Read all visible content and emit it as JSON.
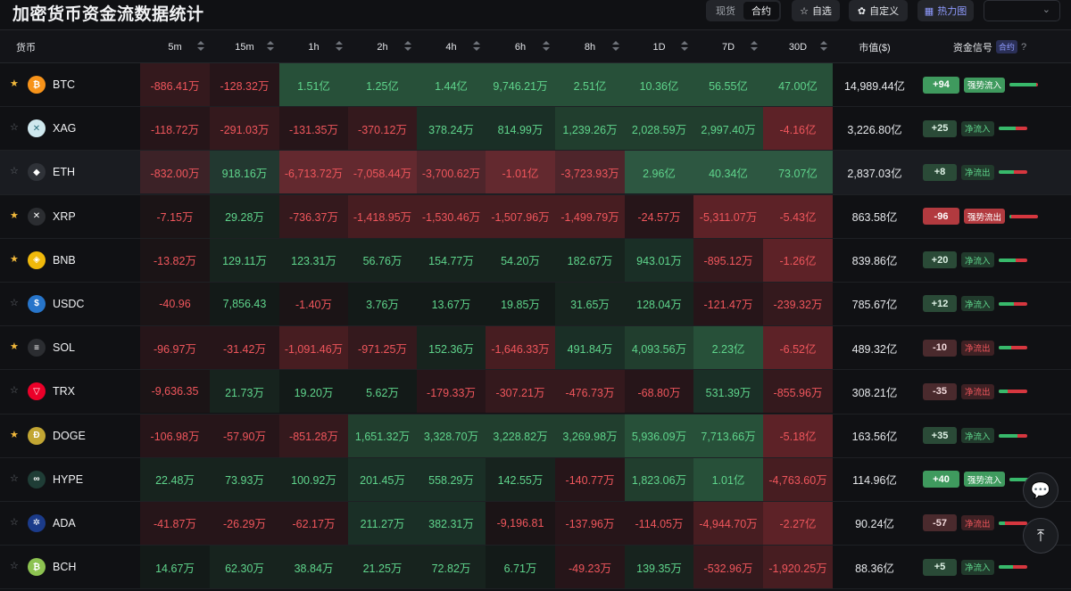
{
  "header": {
    "title": "加密货币资金流数据统计",
    "segment": [
      "现货",
      "合约"
    ],
    "segment_active": 1,
    "buttons": {
      "watchlist": "自选",
      "custom": "自定义",
      "heatmap": "热力图"
    }
  },
  "columns": {
    "coin": "货币",
    "periods": [
      "5m",
      "15m",
      "1h",
      "2h",
      "4h",
      "6h",
      "8h",
      "1D",
      "7D",
      "30D"
    ],
    "mcap": "市值($)",
    "signal": "资金信号",
    "signal_tag": "合约",
    "signal_help": "?"
  },
  "colors": {
    "positive": "#5fd58c",
    "negative": "#f0565c",
    "accent": "#8f9bff",
    "star": "#f2b93b"
  },
  "rows": [
    {
      "symbol": "BTC",
      "star": true,
      "icon": "btc-icon",
      "icon_glyph": "₿",
      "icon_color": "#f7931a",
      "values": [
        "-886.41万",
        "-128.32万",
        "1.51亿",
        "1.25亿",
        "1.44亿",
        "9,746.21万",
        "2.51亿",
        "10.36亿",
        "56.55亿",
        "47.00亿"
      ],
      "mcap": "14,989.44亿",
      "score": "+94",
      "signal": "强势流入",
      "signal_strength": 0.94
    },
    {
      "symbol": "XAG",
      "star": false,
      "icon": "xag-icon",
      "icon_glyph": "✕",
      "icon_color": "#cfe8ee",
      "values": [
        "-118.72万",
        "-291.03万",
        "-131.35万",
        "-370.12万",
        "378.24万",
        "814.99万",
        "1,239.26万",
        "2,028.59万",
        "2,997.40万",
        "-4.16亿"
      ],
      "mcap": "3,226.80亿",
      "score": "+25",
      "signal": "净流入",
      "signal_strength": 0.62
    },
    {
      "symbol": "ETH",
      "star": false,
      "icon": "eth-icon",
      "icon_glyph": "◆",
      "icon_color": "#2f3238",
      "values": [
        "-832.00万",
        "918.16万",
        "-6,713.72万",
        "-7,058.44万",
        "-3,700.62万",
        "-1.01亿",
        "-3,723.93万",
        "2.96亿",
        "40.34亿",
        "73.07亿"
      ],
      "mcap": "2,837.03亿",
      "score": "+8",
      "signal": "净流出",
      "signal_strength": 0.54
    },
    {
      "symbol": "XRP",
      "star": true,
      "icon": "xrp-icon",
      "icon_glyph": "✕",
      "icon_color": "#2b2d31",
      "values": [
        "-7.15万",
        "29.28万",
        "-736.37万",
        "-1,418.95万",
        "-1,530.46万",
        "-1,507.96万",
        "-1,499.79万",
        "-24.57万",
        "-5,311.07万",
        "-5.43亿"
      ],
      "mcap": "863.58亿",
      "score": "-96",
      "signal": "强势流出",
      "signal_strength": 0.06
    },
    {
      "symbol": "BNB",
      "star": true,
      "icon": "bnb-icon",
      "icon_glyph": "◈",
      "icon_color": "#f0b90b",
      "values": [
        "-13.82万",
        "129.11万",
        "123.31万",
        "56.76万",
        "154.77万",
        "54.20万",
        "182.67万",
        "943.01万",
        "-895.12万",
        "-1.26亿"
      ],
      "mcap": "839.86亿",
      "score": "+20",
      "signal": "净流入",
      "signal_strength": 0.6
    },
    {
      "symbol": "USDC",
      "star": false,
      "icon": "usdc-icon",
      "icon_glyph": "$",
      "icon_color": "#2775ca",
      "values": [
        "-40.96",
        "7,856.43",
        "-1.40万",
        "3.76万",
        "13.67万",
        "19.85万",
        "31.65万",
        "128.04万",
        "-121.47万",
        "-239.32万"
      ],
      "mcap": "785.67亿",
      "score": "+12",
      "signal": "净流入",
      "signal_strength": 0.56
    },
    {
      "symbol": "SOL",
      "star": true,
      "icon": "sol-icon",
      "icon_glyph": "≡",
      "icon_color": "#2b2d31",
      "values": [
        "-96.97万",
        "-31.42万",
        "-1,091.46万",
        "-971.25万",
        "152.36万",
        "-1,646.33万",
        "491.84万",
        "4,093.56万",
        "2.23亿",
        "-6.52亿"
      ],
      "mcap": "489.32亿",
      "score": "-10",
      "signal": "净流出",
      "signal_strength": 0.45
    },
    {
      "symbol": "TRX",
      "star": false,
      "icon": "trx-icon",
      "icon_glyph": "▽",
      "icon_color": "#eb0029",
      "values": [
        "-9,636.35",
        "21.73万",
        "19.20万",
        "5.62万",
        "-179.33万",
        "-307.21万",
        "-476.73万",
        "-68.80万",
        "531.39万",
        "-855.96万"
      ],
      "mcap": "308.21亿",
      "score": "-35",
      "signal": "净流出",
      "signal_strength": 0.33
    },
    {
      "symbol": "DOGE",
      "star": true,
      "icon": "doge-icon",
      "icon_glyph": "Ð",
      "icon_color": "#c2a633",
      "values": [
        "-106.98万",
        "-57.90万",
        "-851.28万",
        "1,651.32万",
        "3,328.70万",
        "3,228.82万",
        "3,269.98万",
        "5,936.09万",
        "7,713.66万",
        "-5.18亿"
      ],
      "mcap": "163.56亿",
      "score": "+35",
      "signal": "净流入",
      "signal_strength": 0.68
    },
    {
      "symbol": "HYPE",
      "star": false,
      "icon": "hype-icon",
      "icon_glyph": "∞",
      "icon_color": "#1f3d36",
      "values": [
        "22.48万",
        "73.93万",
        "100.92万",
        "201.45万",
        "558.29万",
        "142.55万",
        "-140.77万",
        "1,823.06万",
        "1.01亿",
        "-4,763.60万"
      ],
      "mcap": "114.96亿",
      "score": "+40",
      "signal": "强势流入",
      "signal_strength": 0.72
    },
    {
      "symbol": "ADA",
      "star": false,
      "icon": "ada-icon",
      "icon_glyph": "✲",
      "icon_color": "#1b3b8a",
      "values": [
        "-41.87万",
        "-26.29万",
        "-62.17万",
        "211.27万",
        "382.31万",
        "-9,196.81",
        "-137.96万",
        "-114.05万",
        "-4,944.70万",
        "-2.27亿"
      ],
      "mcap": "90.24亿",
      "score": "-57",
      "signal": "净流出",
      "signal_strength": 0.22
    },
    {
      "symbol": "BCH",
      "star": false,
      "icon": "bch-icon",
      "icon_glyph": "₿",
      "icon_color": "#8dc351",
      "values": [
        "14.67万",
        "62.30万",
        "38.84万",
        "21.25万",
        "72.82万",
        "6.71万",
        "-49.23万",
        "139.35万",
        "-532.96万",
        "-1,920.25万"
      ],
      "mcap": "88.36亿",
      "score": "+5",
      "signal": "净流入",
      "signal_strength": 0.52
    }
  ]
}
